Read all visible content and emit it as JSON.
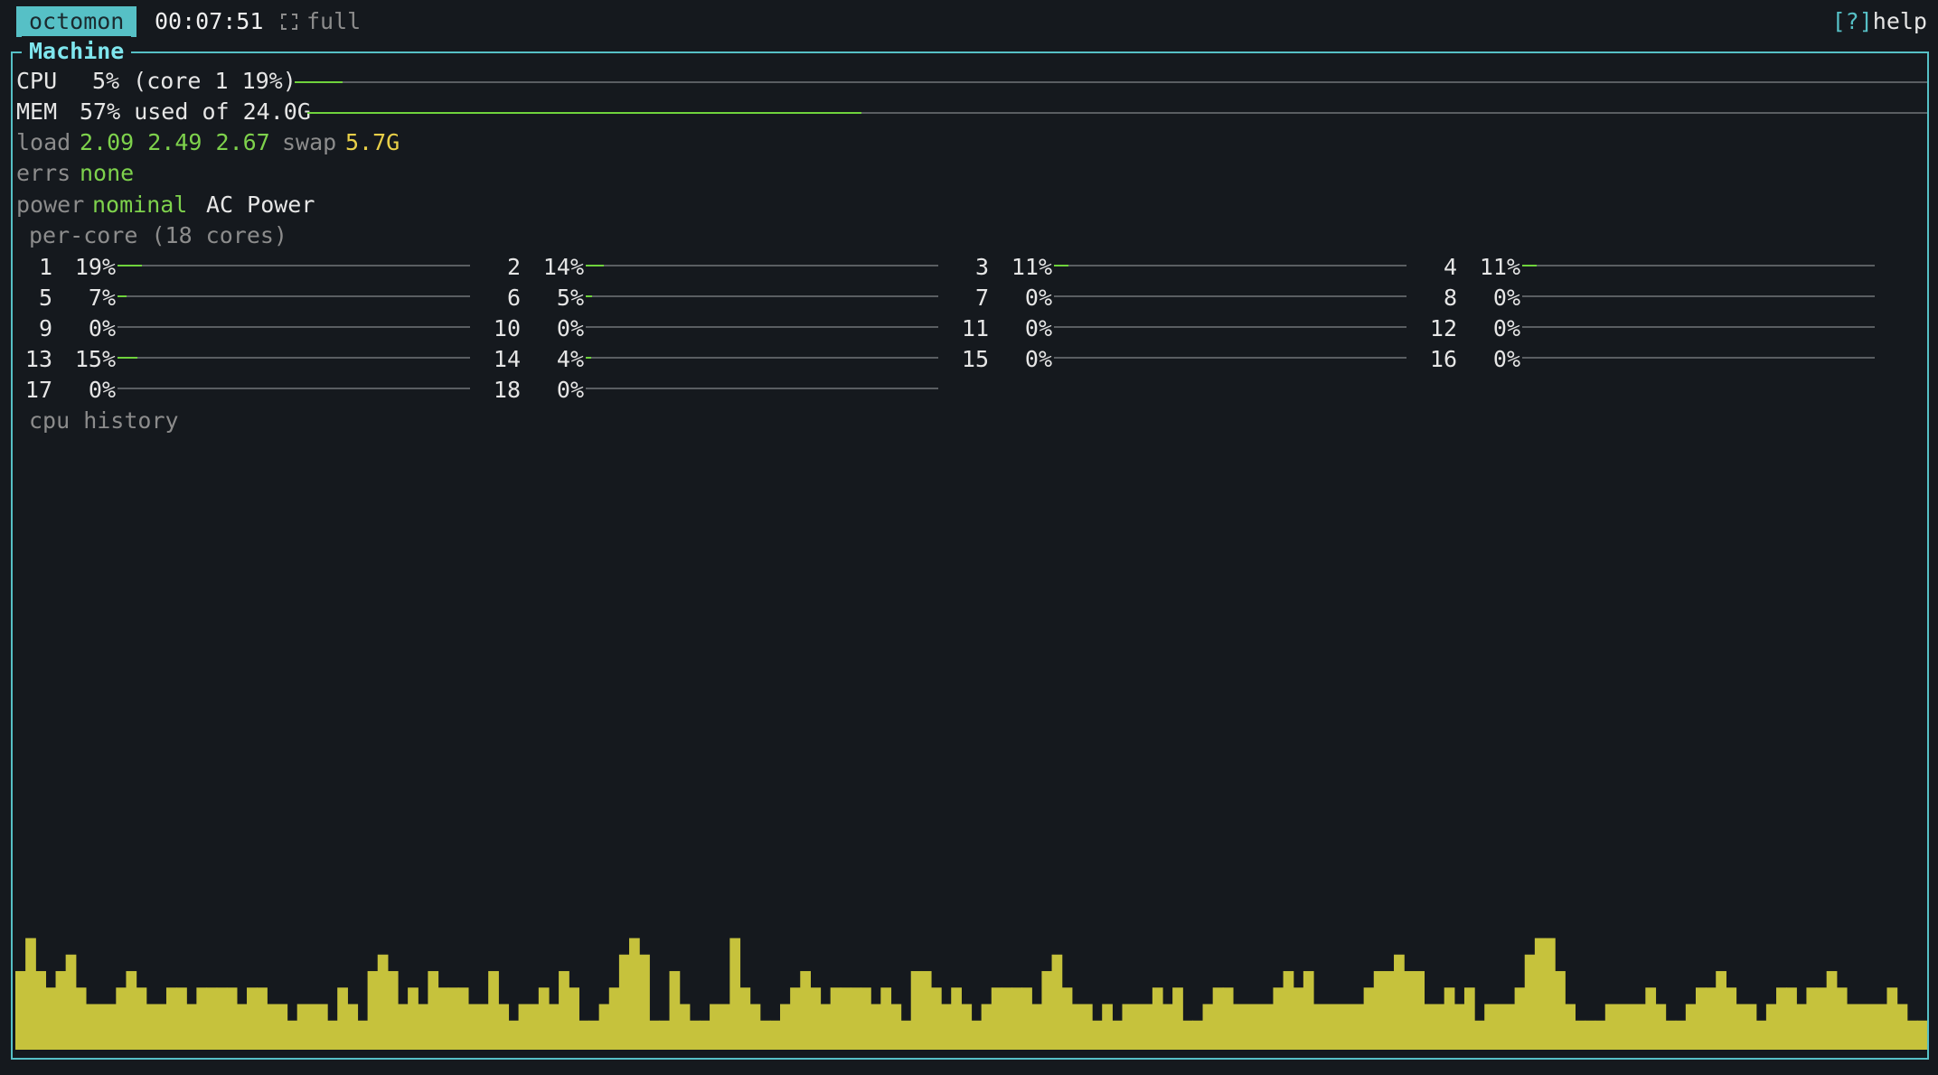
{
  "topbar": {
    "app_name": "octomon",
    "uptime": "00:07:51",
    "mode_label": "full",
    "mode_icon": "fullscreen-icon",
    "help_bracket": "[?]",
    "help_label": "help"
  },
  "panel": {
    "title": "Machine"
  },
  "cpu": {
    "label": "CPU",
    "value": "5% (core 1 19%)",
    "percent": 5
  },
  "mem": {
    "label": "MEM",
    "value": "57% used of 24.0G",
    "percent": 57
  },
  "load": {
    "label": "load",
    "values": "2.09 2.49 2.67",
    "swap_label": "swap",
    "swap_value": "5.7G"
  },
  "errs": {
    "label": "errs",
    "value": "none"
  },
  "power": {
    "label": "power",
    "state": "nominal",
    "source": "AC Power"
  },
  "per_core": {
    "heading": "per-core (18 cores)",
    "cores": [
      {
        "id": "1",
        "pct": "19%",
        "value": 19
      },
      {
        "id": "2",
        "pct": "14%",
        "value": 14
      },
      {
        "id": "3",
        "pct": "11%",
        "value": 11
      },
      {
        "id": "4",
        "pct": "11%",
        "value": 11
      },
      {
        "id": "5",
        "pct": "7%",
        "value": 7
      },
      {
        "id": "6",
        "pct": "5%",
        "value": 5
      },
      {
        "id": "7",
        "pct": "0%",
        "value": 0
      },
      {
        "id": "8",
        "pct": "0%",
        "value": 0
      },
      {
        "id": "9",
        "pct": "0%",
        "value": 0
      },
      {
        "id": "10",
        "pct": "0%",
        "value": 0
      },
      {
        "id": "11",
        "pct": "0%",
        "value": 0
      },
      {
        "id": "12",
        "pct": "0%",
        "value": 0
      },
      {
        "id": "13",
        "pct": "15%",
        "value": 15
      },
      {
        "id": "14",
        "pct": "4%",
        "value": 4
      },
      {
        "id": "15",
        "pct": "0%",
        "value": 0
      },
      {
        "id": "16",
        "pct": "0%",
        "value": 0
      },
      {
        "id": "17",
        "pct": "0%",
        "value": 0
      },
      {
        "id": "18",
        "pct": "0%",
        "value": 0
      }
    ]
  },
  "history": {
    "heading": "cpu history",
    "color": "#c6c23c",
    "values": [
      4,
      6,
      4,
      3,
      4,
      5,
      3,
      2,
      2,
      2,
      3,
      4,
      3,
      2,
      2,
      3,
      3,
      2,
      3,
      3,
      3,
      3,
      2,
      3,
      3,
      2,
      2,
      1,
      2,
      2,
      2,
      1,
      3,
      2,
      1,
      4,
      5,
      4,
      2,
      3,
      2,
      4,
      3,
      3,
      3,
      2,
      2,
      4,
      2,
      1,
      2,
      2,
      3,
      2,
      4,
      3,
      1,
      1,
      2,
      3,
      5,
      6,
      5,
      1,
      1,
      4,
      2,
      1,
      1,
      2,
      2,
      6,
      3,
      2,
      1,
      1,
      2,
      3,
      4,
      3,
      2,
      3,
      3,
      3,
      3,
      2,
      3,
      2,
      1,
      4,
      4,
      3,
      2,
      3,
      2,
      1,
      2,
      3,
      3,
      3,
      3,
      2,
      4,
      5,
      3,
      2,
      2,
      1,
      2,
      1,
      2,
      2,
      2,
      3,
      2,
      3,
      1,
      1,
      2,
      3,
      3,
      2,
      2,
      2,
      2,
      3,
      4,
      3,
      4,
      2,
      2,
      2,
      2,
      2,
      3,
      4,
      4,
      5,
      4,
      4,
      2,
      2,
      3,
      2,
      3,
      1,
      2,
      2,
      2,
      3,
      5,
      6,
      6,
      4,
      2,
      1,
      1,
      1,
      2,
      2,
      2,
      2,
      3,
      2,
      1,
      1,
      2,
      3,
      3,
      4,
      3,
      2,
      2,
      1,
      2,
      3,
      3,
      2,
      3,
      3,
      4,
      3,
      2,
      2,
      2,
      2,
      3,
      2,
      1,
      1
    ]
  }
}
